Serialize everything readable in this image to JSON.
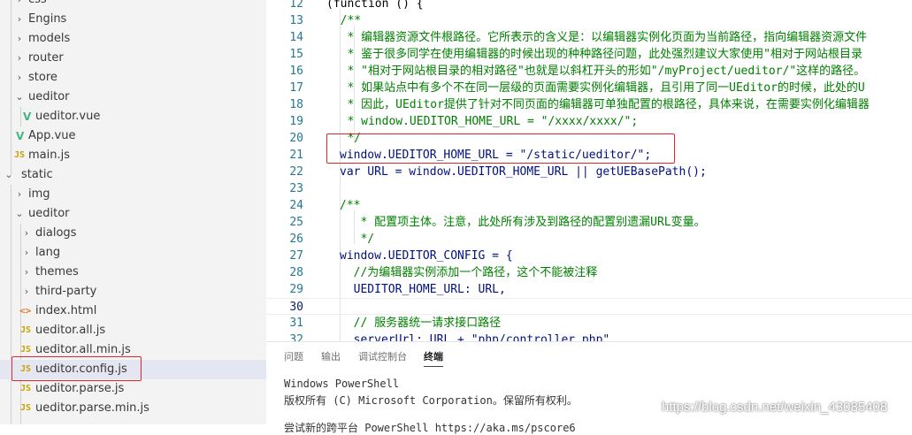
{
  "explorer": {
    "items": [
      {
        "label": "css",
        "icon": "chevron-right-icon"
      },
      {
        "label": "Engins",
        "icon": "chevron-right-icon"
      },
      {
        "label": "models",
        "icon": "chevron-right-icon"
      },
      {
        "label": "router",
        "icon": "chevron-right-icon"
      },
      {
        "label": "store",
        "icon": "chevron-right-icon"
      },
      {
        "label": "ueditor",
        "icon": "chevron-down-icon"
      },
      {
        "label": "ueditor.vue",
        "icon": "vue-file-icon"
      },
      {
        "label": "App.vue",
        "icon": "vue-file-icon"
      },
      {
        "label": "main.js",
        "icon": "js-file-icon"
      },
      {
        "label": "static",
        "icon": "chevron-down-icon"
      },
      {
        "label": "img",
        "icon": "chevron-right-icon"
      },
      {
        "label": "ueditor",
        "icon": "chevron-down-icon"
      },
      {
        "label": "dialogs",
        "icon": "chevron-right-icon"
      },
      {
        "label": "lang",
        "icon": "chevron-right-icon"
      },
      {
        "label": "themes",
        "icon": "chevron-right-icon"
      },
      {
        "label": "third-party",
        "icon": "chevron-right-icon"
      },
      {
        "label": "index.html",
        "icon": "html-file-icon"
      },
      {
        "label": "ueditor.all.js",
        "icon": "js-file-icon"
      },
      {
        "label": "ueditor.all.min.js",
        "icon": "js-file-icon"
      },
      {
        "label": "ueditor.config.js",
        "icon": "js-file-icon"
      },
      {
        "label": "ueditor.parse.js",
        "icon": "js-file-icon"
      },
      {
        "label": "ueditor.parse.min.js",
        "icon": "js-file-icon"
      }
    ],
    "js_badge": "JS",
    "html_badge": "<>",
    "vue_badge": "V",
    "selected": "ueditor.config.js"
  },
  "editor": {
    "lines": [
      {
        "n": "12",
        "text": "(function () {"
      },
      {
        "n": "13",
        "text": "  /**"
      },
      {
        "n": "14",
        "text": "   * 编辑器资源文件根路径。它所表示的含义是：以编辑器实例化页面为当前路径，指向编辑器资源文件"
      },
      {
        "n": "15",
        "text": "   * 鉴于很多同学在使用编辑器的时候出现的种种路径问题，此处强烈建议大家使用\"相对于网站根目录"
      },
      {
        "n": "16",
        "text": "   * \"相对于网站根目录的相对路径\"也就是以斜杠开头的形如\"/myProject/ueditor/\"这样的路径。"
      },
      {
        "n": "17",
        "text": "   * 如果站点中有多个不在同一层级的页面需要实例化编辑器，且引用了同一UEditor的时候，此处的U"
      },
      {
        "n": "18",
        "text": "   * 因此，UEditor提供了针对不同页面的编辑器可单独配置的根路径，具体来说，在需要实例化编辑器"
      },
      {
        "n": "19",
        "text": "   * window.UEDITOR_HOME_URL = \"/xxxx/xxxx/\";"
      },
      {
        "n": "20",
        "text": "   */"
      },
      {
        "n": "21",
        "text": "window.UEDITOR_HOME_URL = \"/static/ueditor/\";"
      },
      {
        "n": "22",
        "text": "var URL = window.UEDITOR_HOME_URL || getUEBasePath();"
      },
      {
        "n": "23",
        "text": ""
      },
      {
        "n": "24",
        "text": "/**"
      },
      {
        "n": "25",
        "text": "   * 配置项主体。注意，此处所有涉及到路径的配置别遗漏URL变量。"
      },
      {
        "n": "26",
        "text": "   */"
      },
      {
        "n": "27",
        "text": "window.UEDITOR_CONFIG = {"
      },
      {
        "n": "28",
        "text": "  //为编辑器实例添加一个路径，这个不能被注释"
      },
      {
        "n": "29",
        "text": "  UEDITOR_HOME_URL: URL,"
      },
      {
        "n": "30",
        "text": ""
      },
      {
        "n": "31",
        "text": "  // 服务器统一请求接口路径"
      },
      {
        "n": "32",
        "text": "  serverUrl: URL + \"php/controller.php\","
      }
    ],
    "active_line": "30"
  },
  "panel": {
    "tabs": [
      {
        "label": "问题"
      },
      {
        "label": "输出"
      },
      {
        "label": "调试控制台"
      },
      {
        "label": "终端"
      }
    ],
    "active_tab": "终端",
    "terminal": [
      "Windows PowerShell",
      "版权所有 (C) Microsoft Corporation。保留所有权利。",
      "尝试新的跨平台 PowerShell https://aka.ms/pscore6"
    ]
  },
  "watermark": "https://blog.csdn.net/weixin_43085408",
  "colors": {
    "annotation": "#e0262b",
    "comment": "#008000",
    "keyword": "#0000ff",
    "string": "#a31515",
    "variable": "#001080",
    "function": "#795e26"
  }
}
